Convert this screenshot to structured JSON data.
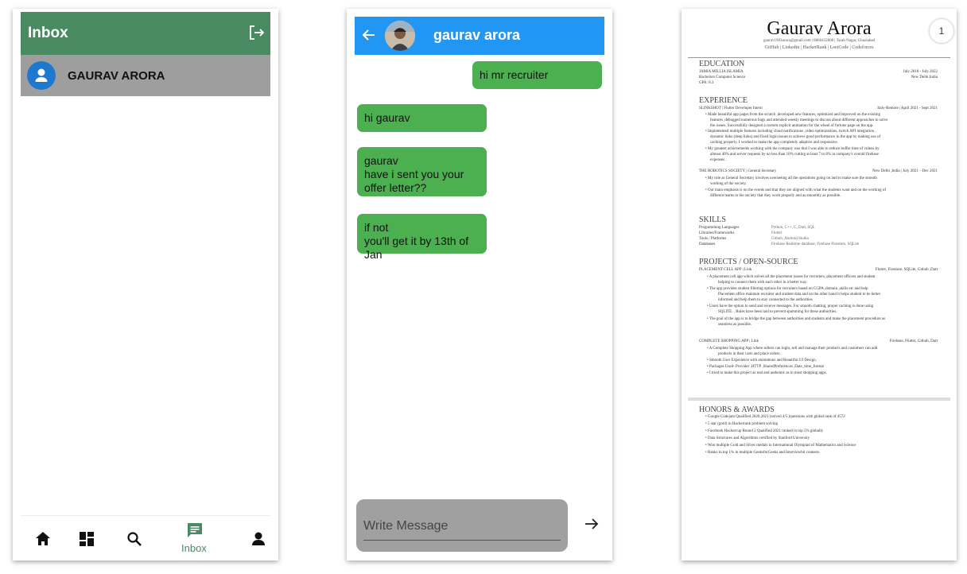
{
  "inbox": {
    "title": "Inbox",
    "contact_name": "GAURAV ARORA",
    "nav": {
      "inbox_label": "Inbox"
    },
    "colors": {
      "bar": "#4a8a62",
      "row": "#9e9e9e",
      "avatar": "#1f77d0"
    }
  },
  "chat": {
    "name": "gaurav arora",
    "messages": [
      {
        "from": "me",
        "text": "hi mr recruiter"
      },
      {
        "from": "me",
        "text": "hi gaurav"
      },
      {
        "from": "me",
        "text": "gaurav\nhave i sent you your offer letter??"
      },
      {
        "from": "me",
        "text": "if not\nyou'll get it by 13th of Jan"
      }
    ],
    "compose_placeholder": "Write Message",
    "colors": {
      "bar": "#2196f3",
      "bubble": "#4caf50"
    }
  },
  "resume": {
    "name": "Gaurav Arora",
    "contact": "gaurav1903arora@gmail.com | 8860432808 | Tarab Nagar, Ghaziabad",
    "links": "GitHub | Linkedin | HackerRank | LeetCode | Codeforces",
    "page_number": "1",
    "education": {
      "heading": "EDUCATION",
      "school": "JAMIA MILLIA ISLAMIA",
      "dates": "July 2018 - July 2022",
      "degree": "Bachelors Computer Science",
      "location": "New Delhi India",
      "gpa": "GPA: 8.3"
    },
    "experience": {
      "heading": "EXPERIENCE",
      "job1_title": "SLINKSHOT | Flutter Developer Intern",
      "job1_meta": "Italy-Remote | April 2021 - Sept 2021",
      "job1_lines": [
        "• Made beautiful app pages from the scratch ,developed new features, optimized and improved on the existing",
        "features ,debugged numerous bugs and attended weekly meetings to discuss about different approaches to solve",
        "the issues. Successfully designed a custom explicit animation for the wheel of fortune page on the app.",
        "• Implemented multiple features including cloud notifications ,video optimizations, twitch API integration ,",
        "dynamic links (deep links) and fixed login issues to achieve good performance in the app by making use of",
        "caching properly. I worked to make the app completely adaptive and responsive.",
        "• My greatest achievements working with the company was that I was able to reduce buffer time of videos by",
        "almost 40% and server requests by no less than 10% cutting at least 7 to 8% in company's overall firebase",
        "expenses ."
      ],
      "job2_title": "THE ROBOTICS SOCIETY | General Secretary",
      "job2_meta": "New Delhi ,India | July 2021 – Dec 2021",
      "job2_lines": [
        "• My role as General Secretary involves overseeing all the operations going on and to make sure the smooth",
        "working of the society.",
        "• Our main emphasis is on the events and that they are aligned with what the students want and on the working of",
        "different teams in the society that they work properly and as smoothly as possible."
      ]
    },
    "skills": {
      "heading": "SKILLS",
      "rows": [
        {
          "label": "Programming Languages",
          "value": "Python, C++, C, Dart, SQL"
        },
        {
          "label": "Libraries/Frameworks",
          "value": "Flutter"
        },
        {
          "label": "Tools / Platforms",
          "value": "Github, Android Studio"
        },
        {
          "label": "Databases",
          "value": "Firebase Realtime database, Firebase Firestore, SQLite"
        }
      ]
    },
    "projects": {
      "heading": "PROJECTS / OPEN-SOURCE",
      "p1_title": "PLACEMENT CELL APP | Link",
      "p1_meta": "Flutter, Firestore, SQLite, Github ,Dart",
      "p1_lines": [
        "• A placement cell app which solves all the placement issues for recruiters, placement officers and student",
        "helping to connect them with each other in a better way.",
        "• The app provides student filtering options for recruiters based on CGPA ,domain ,skills etc and help",
        "Placement office maintain recruiter and student data and on the other hand it helps student to be better",
        "informed and help them to stay connected to the authorities",
        "• Users have the option to send and receive messages. For smooth chatting, proper caching is done using",
        "SQLITE. . Rules have been laid to prevent spamming for these authorities.",
        "• The goal of the app is to bridge the gap between authorities and students and make the placement procedure as",
        "seamless as possible."
      ],
      "p2_title": "COMPLETE SHOPPING APP | Link",
      "p2_meta": "Firebase, Flutter, Github, Dart",
      "p2_lines": [
        "• A Complete Shopping App where sellers can login, sell and manage their products and customers can add",
        "products in their carts and place orders.",
        "• Smooth User Experience with animations and Beautiful UI Design.",
        "• Packages Used- Provider ,HTTP ,SharedPreferences ,Date_time_format",
        "• I tried to make this project as real and authentic as in most shopping apps."
      ]
    },
    "honors": {
      "heading": "HONORS & AWARDS",
      "lines": [
        "• Google Codejam Qualified 2020,2021 (solved 4/5 )questions with global rank of 4572",
        "• 5 star (gold) in Hackerrank problem solving",
        "• Facebook Hackercup Round 2 Qualified 2021 ranked in top 5% globally",
        "• Data Structures and Algorithms certified by Stanford University",
        "• Won multiple Gold and Silver medals in International Olympiad of Mathematics and Science",
        "• Ranks in top 1% in multiple GeeksforGeeks and Interviewbit contests."
      ]
    }
  }
}
